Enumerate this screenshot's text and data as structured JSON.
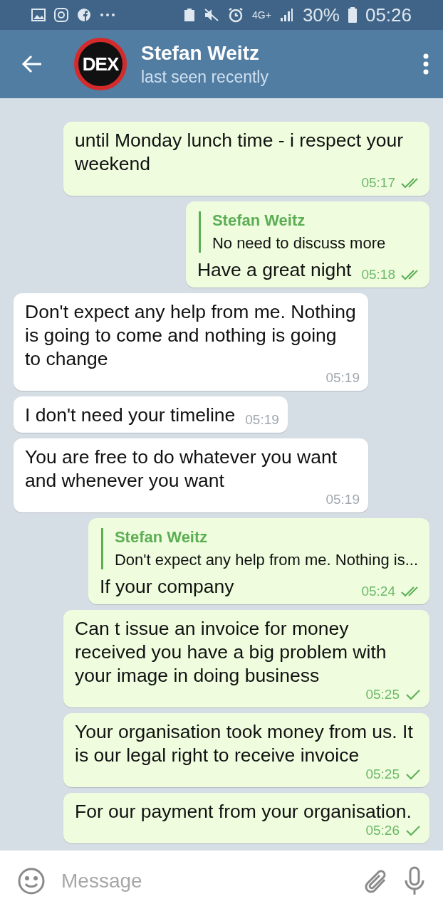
{
  "status_bar": {
    "network": "4G+",
    "battery": "30%",
    "time": "05:26"
  },
  "header": {
    "avatar_text": "DEX",
    "title": "Stefan Weitz",
    "subtitle": "last seen recently"
  },
  "messages": [
    {
      "outgoing": true,
      "text": "until Monday lunch time - i respect your weekend",
      "time": "05:17",
      "read": true
    },
    {
      "outgoing": true,
      "reply": {
        "author": "Stefan Weitz",
        "text": "No need to discuss more"
      },
      "text": "Have a great night",
      "time": "05:18",
      "read": true
    },
    {
      "outgoing": false,
      "text": "Don't expect any help from me. Nothing is going to come and nothing is going to change",
      "time": "05:19"
    },
    {
      "outgoing": false,
      "text": "I don't need your timeline",
      "time": "05:19"
    },
    {
      "outgoing": false,
      "text": "You are free to do whatever you want and whenever you want",
      "time": "05:19"
    },
    {
      "outgoing": true,
      "reply": {
        "author": "Stefan Weitz",
        "text": "Don't expect any help from me. Nothing is..."
      },
      "text": "If your company",
      "time": "05:24",
      "read": true
    },
    {
      "outgoing": true,
      "text": "Can t issue an invoice for money received you have a big problem with your image in doing business",
      "time": "05:25",
      "read": false
    },
    {
      "outgoing": true,
      "text": "Your organisation took money from us. It is our legal right to receive invoice",
      "time": "05:25",
      "read": false
    },
    {
      "outgoing": true,
      "text": "For our payment from your organisation.",
      "time": "05:26",
      "read": false
    }
  ],
  "composer": {
    "placeholder": "Message"
  }
}
